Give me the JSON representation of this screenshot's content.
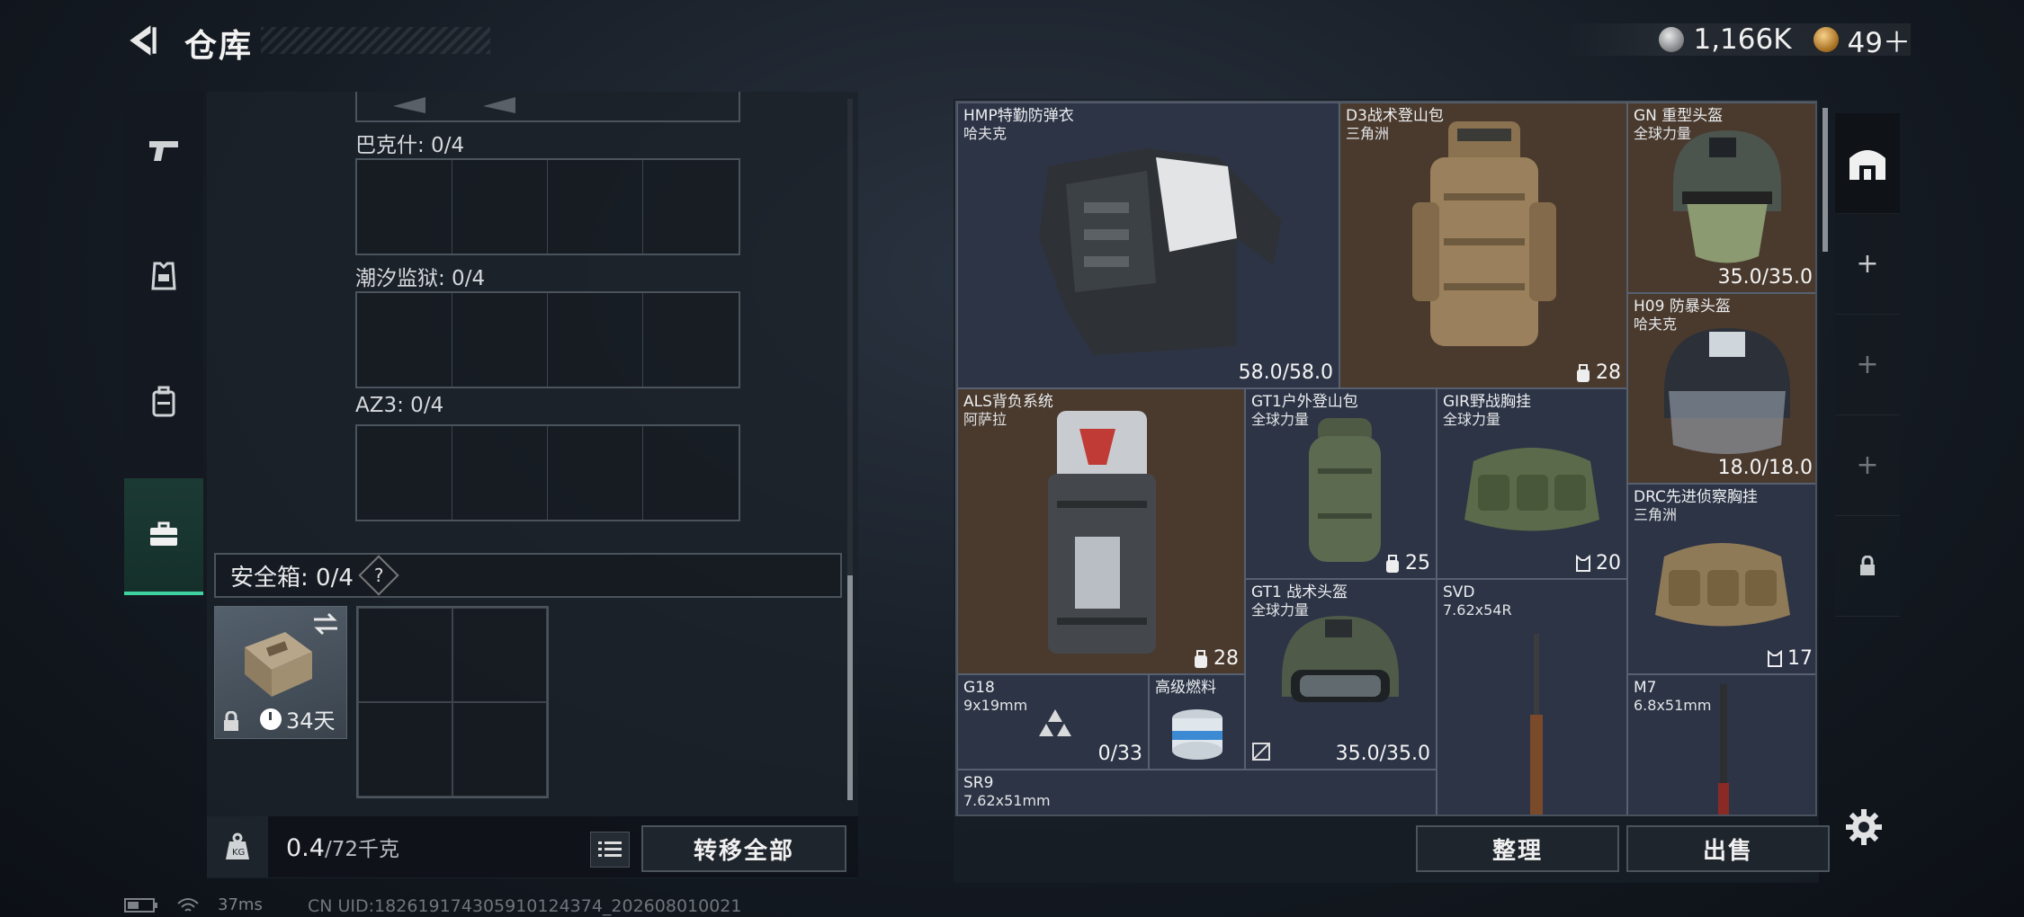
{
  "header": {
    "title": "仓库",
    "silver_amount": "1,166K",
    "gold_amount": "49＋"
  },
  "rail": {
    "items": [
      {
        "icon": "pistol-icon"
      },
      {
        "icon": "vest-icon"
      },
      {
        "icon": "backpack-icon"
      },
      {
        "icon": "briefcase-icon",
        "active": true
      }
    ]
  },
  "storage": {
    "sections": [
      {
        "label": "巴克什: 0/4"
      },
      {
        "label": "潮汐监狱: 0/4"
      },
      {
        "label": "AZ3: 0/4"
      }
    ],
    "safebox_label": "安全箱: 0/4",
    "safebox_help": "?",
    "safebox_days": "34天"
  },
  "weight": {
    "current": "0.4",
    "max": "/72千克"
  },
  "buttons": {
    "transfer_all": "转移全部",
    "sort": "整理",
    "sell": "出售"
  },
  "inventory": {
    "items": [
      {
        "name": "HMP特勤防弹衣",
        "sub": "哈夫克",
        "value": "58.0/58.0"
      },
      {
        "name": "D3战术登山包",
        "sub": "三角洲",
        "count": "28"
      },
      {
        "name": "GN 重型头盔",
        "sub": "全球力量",
        "value": "35.0/35.0"
      },
      {
        "name": "H09 防暴头盔",
        "sub": "哈夫克",
        "value": "18.0/18.0"
      },
      {
        "name": "ALS背负系统",
        "sub": "阿萨拉",
        "count": "28"
      },
      {
        "name": "GT1户外登山包",
        "sub": "全球力量",
        "count": "25"
      },
      {
        "name": "GIR野战胸挂",
        "sub": "全球力量",
        "count": "20"
      },
      {
        "name": "DRC先进侦察胸挂",
        "sub": "三角洲",
        "count": "17"
      },
      {
        "name": "GT1 战术头盔",
        "sub": "全球力量",
        "value": "35.0/35.0"
      },
      {
        "name": "SVD",
        "sub": "7.62x54R"
      },
      {
        "name": "G18",
        "sub": "9x19mm",
        "value": "0/33"
      },
      {
        "name": "高级燃料"
      },
      {
        "name": "M7",
        "sub": "6.8x51mm"
      },
      {
        "name": "SR9",
        "sub": "7.62x51mm"
      }
    ]
  },
  "status": {
    "ping": "37ms",
    "uid": "CN UID:18261917430591012437​4_202608010021"
  }
}
